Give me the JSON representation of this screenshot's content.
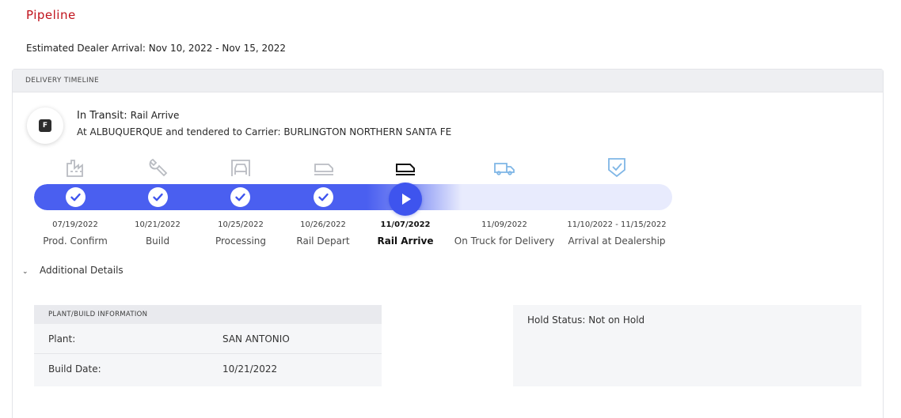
{
  "page": {
    "title": "Pipeline",
    "eta": "Estimated Dealer Arrival: Nov 10, 2022 - Nov 15, 2022"
  },
  "timeline": {
    "header": "DELIVERY TIMELINE",
    "status_badge": "F",
    "status_label": "In Transit:",
    "status_value": "Rail Arrive",
    "status_detail": "At ALBUQUERQUE and tendered to Carrier: BURLINGTON NORTHERN SANTA FE",
    "progress_completed_stages": 4,
    "current_stage_index": 4,
    "stages": [
      {
        "date": "07/19/2022",
        "label": "Prod. Confirm",
        "icon": "factory-icon",
        "state": "complete"
      },
      {
        "date": "10/21/2022",
        "label": "Build",
        "icon": "wrench-icon",
        "state": "complete"
      },
      {
        "date": "10/25/2022",
        "label": "Processing",
        "icon": "car-wash-icon",
        "state": "complete"
      },
      {
        "date": "10/26/2022",
        "label": "Rail Depart",
        "icon": "rail-icon",
        "state": "complete"
      },
      {
        "date": "11/07/2022",
        "label": "Rail Arrive",
        "icon": "rail-icon",
        "state": "current"
      },
      {
        "date": "11/09/2022",
        "label": "On Truck for Delivery",
        "icon": "truck-icon",
        "state": "upcoming"
      },
      {
        "date": "11/10/2022 - 11/15/2022",
        "label": "Arrival at Dealership",
        "icon": "shield-check-icon",
        "state": "upcoming"
      }
    ],
    "colors": {
      "accent": "#3e54ee",
      "track": "#e8ebfd",
      "upcoming_icon": "#7fb6e6",
      "complete_icon": "#b9bcc2",
      "title_red": "#c0121b"
    }
  },
  "additional": {
    "toggle_label": "Additional Details",
    "plant": {
      "header": "PLANT/BUILD INFORMATION",
      "plant_label": "Plant:",
      "plant_value": "SAN ANTONIO",
      "build_date_label": "Build Date:",
      "build_date_value": "10/21/2022"
    },
    "hold_status": "Hold Status: Not on Hold"
  }
}
